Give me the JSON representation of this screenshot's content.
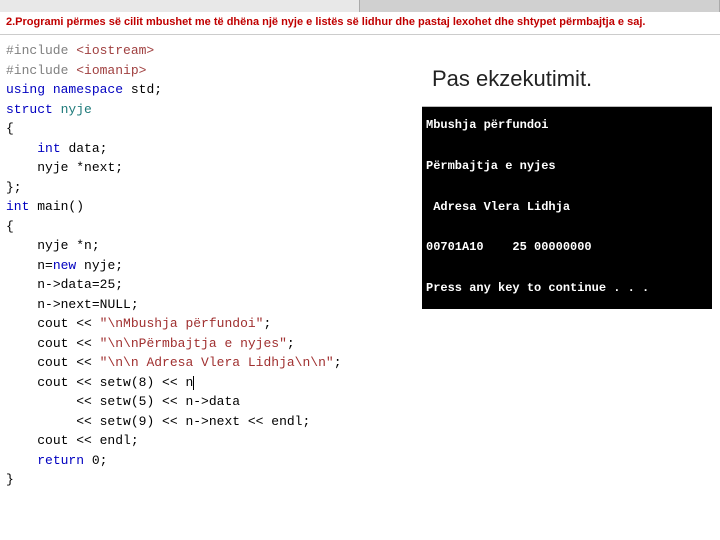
{
  "heading": "2.Programi përmes së cilit mbushet me të dhëna një nyje e listës së lidhur dhe pastaj lexohet dhe shtypet përmbajtja e saj.",
  "code": {
    "l01_pp": "#include ",
    "l01_inc": "<iostream>",
    "l02_pp": "#include ",
    "l02_inc": "<iomanip>",
    "l03_kw1": "using",
    "l03_kw2": "namespace",
    "l03_id": "std",
    "l04_kw": "struct",
    "l04_id": "nyje",
    "l05": "{",
    "l06_kw": "int",
    "l06_id": "data",
    "l07_a": "nyje ",
    "l07_b": "*next",
    "l08": "};",
    "l09_kw": "int",
    "l09_id": "main()",
    "l10": "{",
    "l11": "nyje *n;",
    "l12_a": "n=",
    "l12_kw": "new",
    "l12_b": " nyje;",
    "l13_a": "n->data=",
    "l13_n": "25",
    "l13_b": ";",
    "l14_a": "n->next=",
    "l14_n": "NULL",
    "l14_b": ";",
    "l15_a": "cout << ",
    "l15_s": "\"\\nMbushja përfundoi\"",
    "l15_b": ";",
    "l16_a": "cout << ",
    "l16_s": "\"\\n\\nPërmbajtja e nyjes\"",
    "l16_b": ";",
    "l17_a": "cout << ",
    "l17_s": "\"\\n\\n Adresa Vlera Lidhja\\n\\n\"",
    "l17_b": ";",
    "l18_a": "cout << setw(",
    "l18_n": "8",
    "l18_b": ") << n",
    "l19_a": "     << setw(",
    "l19_n": "5",
    "l19_b": ") << n->data",
    "l20_a": "     << setw(",
    "l20_n": "9",
    "l20_b": ") << n->next << endl;",
    "l21": "cout << endl;",
    "l22_kw": "return",
    "l22_n": "0",
    "l22_b": ";",
    "l23": "}"
  },
  "output": {
    "title": "Pas ekzekutimit.",
    "l1": "Mbushja përfundoi",
    "l2": "Përmbajtja e nyjes",
    "l3": " Adresa Vlera Lidhja",
    "l4": "00701A10    25 00000000",
    "l5": "Press any key to continue . . ."
  }
}
